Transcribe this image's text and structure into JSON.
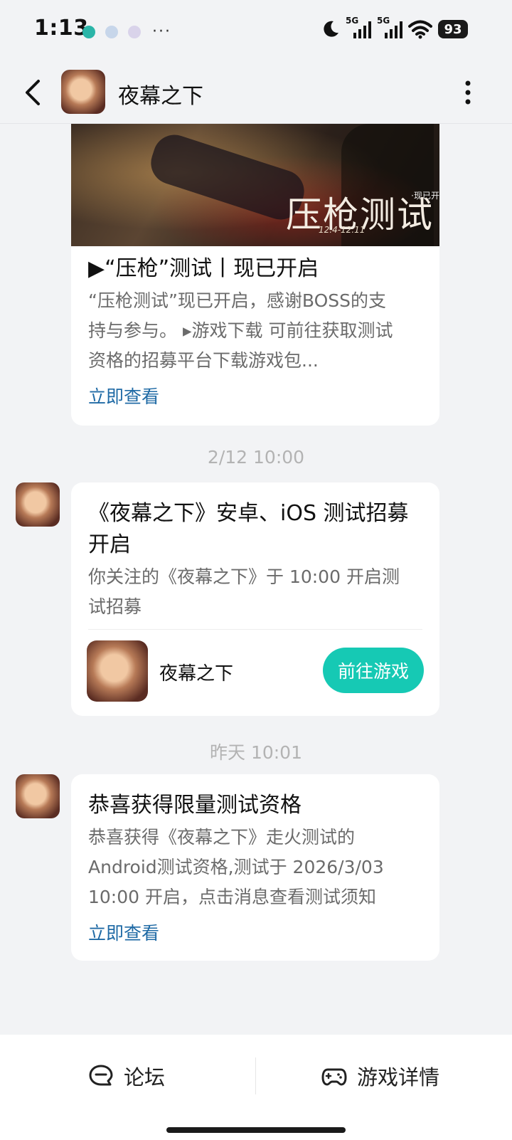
{
  "status_bar": {
    "time": "1:13",
    "more": "···",
    "signal1_tag": "5G",
    "signal2_tag": "5G",
    "battery": "93"
  },
  "header": {
    "title": "夜幕之下"
  },
  "card1": {
    "banner_text": "压枪测试",
    "banner_dates": "12.4-12.11",
    "banner_now": "·现已开",
    "title": "▶“压枪”测试丨现已开启",
    "body_lines": [
      "“压枪测试”现已开启，感谢BOSS的支",
      "持与参与。 ▸游戏下载 可前往获取测试",
      "资格的招募平台下载游戏包..."
    ],
    "link": "立即查看"
  },
  "time_label_1": "2/12  10:00",
  "card2": {
    "title_lines": [
      "《夜幕之下》安卓、iOS 测试招募",
      "开启"
    ],
    "body_lines": [
      "你关注的《夜幕之下》于 10:00 开启测",
      "试招募"
    ],
    "game_name": "夜幕之下",
    "button": "前往游戏"
  },
  "time_label_2": "昨天  10:01",
  "card3": {
    "title": "恭喜获得限量测试资格",
    "body_lines": [
      "恭喜获得《夜幕之下》走火测试的",
      "Android测试资格,测试于 2026/3/03",
      "10:00 开启，点击消息查看测试须知"
    ],
    "link": "立即查看"
  },
  "bottom_bar": {
    "forum_label": "论坛",
    "details_label": "游戏详情"
  },
  "colors": {
    "accent": "#16c9b4",
    "link": "#1f6aa5",
    "background": "#f2f3f5"
  }
}
